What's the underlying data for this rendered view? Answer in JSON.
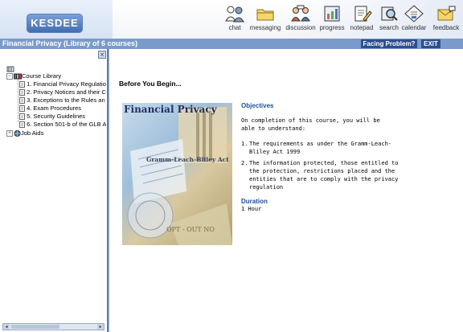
{
  "brand": {
    "logo_text": "KESDEE"
  },
  "toolbar": {
    "items": [
      {
        "label": "chat",
        "icon": "chat-people-icon"
      },
      {
        "label": "messaging",
        "icon": "folder-mail-icon"
      },
      {
        "label": "discussion",
        "icon": "discussion-people-icon"
      },
      {
        "label": "progress",
        "icon": "progress-chart-icon"
      },
      {
        "label": "notepad",
        "icon": "notepad-pencil-icon"
      },
      {
        "label": "search",
        "icon": "search-magnifier-icon"
      },
      {
        "label": "calendar",
        "icon": "calendar-diamond-icon"
      },
      {
        "label": "feedback",
        "icon": "feedback-envelope-icon"
      }
    ]
  },
  "titlebar": {
    "course_title": "Financial Privacy (Library of 6 courses)",
    "facing_problem_label": "Facing Problem?",
    "exit_label": "EXIT"
  },
  "tree": {
    "root_label": "Course Library",
    "courses": [
      "1. Financial Privacy Regulatio",
      "2. Privacy Notices and their C",
      "3. Exceptions to the Rules an",
      "4. Exam Procedures",
      "5. Security Guidelines",
      "6. Section 501-b of the GLB A"
    ],
    "job_aids_label": "Job Aids",
    "expander_expanded": "−",
    "expander_collapsed": "+"
  },
  "main": {
    "heading": "Before You Begin...",
    "image_title": "Financial Privacy",
    "image_caption": "Gramm-Leach-Bliley Act",
    "image_optout": "OPT - OUT NO",
    "objectives_title": "Objectives",
    "objectives_intro": "On completion of this course, you will be able to understand:",
    "objectives": [
      {
        "num": "1.",
        "text": "The requirements as under the Gramm-Leach-Bliley Act 1999"
      },
      {
        "num": "2.",
        "text": "The information protected, those entitled to the protection, restrictions placed and the entities that are to comply with the privacy regulation"
      }
    ],
    "duration_title": "Duration",
    "duration_value": "1 Hour"
  },
  "colors": {
    "titlebar_bg": "#7a9bc9",
    "button_bg": "#2b4f8f",
    "accent_text": "#1b4f9b",
    "pane_border": "#5b7db5"
  }
}
